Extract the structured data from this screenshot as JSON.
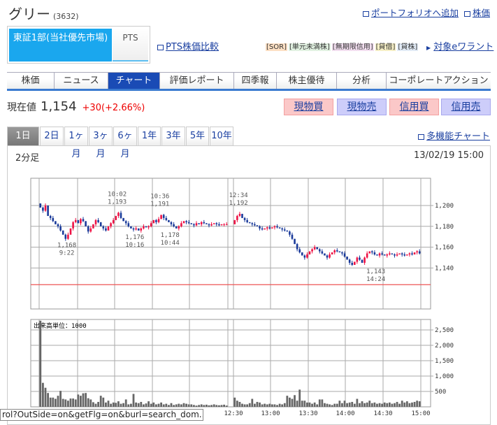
{
  "header": {
    "title": "グリー",
    "code": "(3632)",
    "portfolio_link": "ポートフォリオへ追加",
    "stock_link": "株価"
  },
  "market_tabs": [
    {
      "label": "東証1部(当社優先市場)",
      "active": true
    },
    {
      "label": "PTS",
      "active": false
    }
  ],
  "pts_compare": "PTS株価比較",
  "tags": [
    {
      "label": "[SOR]",
      "color": "#fde0c4"
    },
    {
      "label": "[単元未満株]",
      "color": "#e2f2e2"
    },
    {
      "label": "[無期限信用]",
      "color": "#f3dff0"
    },
    {
      "label": "[貸借]",
      "color": "#f6efc6"
    },
    {
      "label": "[貸株]",
      "color": "#e2ebf6"
    }
  ],
  "ewarrant_link": "対象eワラント",
  "nav": [
    "株価",
    "ニュース",
    "チャート",
    "評価レポート",
    "四季報",
    "株主優待",
    "分析",
    "コーポレートアクション"
  ],
  "price": {
    "label": "現在値",
    "value": "1,154",
    "change": "+30(+2.66%)"
  },
  "trade_buttons": [
    "現物買",
    "現物売",
    "信用買",
    "信用売"
  ],
  "periods": [
    "1日",
    "2日",
    "1ヶ月",
    "3ヶ月",
    "6ヶ月",
    "1年",
    "3年",
    "5年",
    "10年"
  ],
  "multichart_link": "多機能チャート",
  "chart_header": {
    "interval": "2分足",
    "timestamp": "13/02/19 15:00"
  },
  "status_bar": "rol?OutSide=on&getFlg=on&burl=search_dom...",
  "colors": {
    "up": "#ee1144",
    "down": "#1a3a9a",
    "prev_close": "#ee5555"
  },
  "chart_data": {
    "type": "candlestick",
    "interval_minutes": 2,
    "price_axis": {
      "ticks": [
        "1,200",
        "1,180",
        "1,160",
        "1,140"
      ],
      "values": [
        1200,
        1180,
        1160,
        1140
      ],
      "ylim": [
        1114,
        1226
      ]
    },
    "prev_close": 1124,
    "volume_axis": {
      "label": "出来高単位：1000",
      "ticks": [
        "2,500",
        "2,000",
        "1,500",
        "1,000",
        "500"
      ],
      "values": [
        2500,
        2000,
        1500,
        1000,
        500
      ],
      "ylim": [
        0,
        2840
      ]
    },
    "time_ticks": [
      "12:30",
      "13:00",
      "13:30",
      "14:00",
      "14:30",
      "15:00"
    ],
    "annotations": [
      {
        "time": "9:22",
        "price": "1,168",
        "pos": "below"
      },
      {
        "time": "10:02",
        "price": "1,193",
        "pos": "above"
      },
      {
        "time": "10:16",
        "price": "1,176",
        "pos": "below"
      },
      {
        "time": "10:36",
        "price": "1,191",
        "pos": "above"
      },
      {
        "time": "10:44",
        "price": "1,178",
        "pos": "below"
      },
      {
        "time": "12:34",
        "price": "1,192",
        "pos": "above"
      },
      {
        "time": "14:24",
        "price": "1,143",
        "pos": "below"
      }
    ],
    "morning_close": [
      1198,
      1195,
      1200,
      1190,
      1188,
      1185,
      1182,
      1180,
      1176,
      1172,
      1168,
      1172,
      1178,
      1184,
      1186,
      1183,
      1187,
      1185,
      1180,
      1175,
      1178,
      1182,
      1186,
      1184,
      1180,
      1178,
      1176,
      1180,
      1183,
      1186,
      1190,
      1193,
      1188,
      1185,
      1183,
      1180,
      1178,
      1177,
      1178,
      1176,
      1178,
      1180,
      1179,
      1180,
      1183,
      1186,
      1184,
      1187,
      1191,
      1188,
      1186,
      1184,
      1182,
      1180,
      1178,
      1180,
      1183,
      1185,
      1184,
      1183,
      1182,
      1181,
      1183,
      1182,
      1184,
      1183,
      1182,
      1181,
      1182,
      1183,
      1182,
      1181,
      1182,
      1182,
      1182
    ],
    "afternoon_close": [
      1186,
      1190,
      1192,
      1188,
      1186,
      1184,
      1183,
      1182,
      1181,
      1180,
      1178,
      1177,
      1178,
      1179,
      1178,
      1179,
      1180,
      1179,
      1178,
      1177,
      1176,
      1175,
      1172,
      1168,
      1163,
      1158,
      1155,
      1152,
      1150,
      1153,
      1156,
      1158,
      1160,
      1158,
      1156,
      1154,
      1152,
      1150,
      1153,
      1155,
      1157,
      1156,
      1155,
      1154,
      1151,
      1148,
      1145,
      1143,
      1146,
      1150,
      1148,
      1145,
      1150,
      1154,
      1156,
      1155,
      1153,
      1152,
      1154,
      1153,
      1152,
      1153,
      1154,
      1153,
      1152,
      1153,
      1154,
      1153,
      1152,
      1153,
      1154,
      1153,
      1155,
      1156,
      1154
    ],
    "morning_volume": [
      2800,
      780,
      620,
      450,
      300,
      300,
      260,
      360,
      520,
      260,
      240,
      200,
      270,
      270,
      240,
      400,
      360,
      440,
      450,
      280,
      240,
      150,
      100,
      160,
      360,
      300,
      140,
      200,
      100,
      140,
      130,
      180,
      100,
      120,
      240,
      80,
      100,
      420,
      140,
      120,
      160,
      80,
      110,
      180,
      100,
      140,
      80,
      100,
      140,
      80,
      100,
      60,
      120,
      60,
      80,
      100,
      80,
      120,
      100,
      80,
      80,
      60,
      40,
      60,
      80,
      60,
      70,
      50,
      60,
      80,
      60,
      50,
      60,
      70,
      40
    ],
    "afternoon_volume": [
      300,
      200,
      160,
      100,
      80,
      80,
      120,
      260,
      100,
      160,
      140,
      80,
      100,
      80,
      100,
      80,
      80,
      60,
      100,
      80,
      120,
      360,
      300,
      260,
      380,
      200,
      560,
      200,
      200,
      140,
      140,
      100,
      140,
      80,
      240,
      240,
      120,
      100,
      80,
      60,
      100,
      100,
      200,
      120,
      200,
      120,
      140,
      160,
      100,
      260,
      120,
      180,
      120,
      140,
      200,
      120,
      140,
      100,
      120,
      100,
      140,
      120,
      140,
      100,
      120,
      160,
      100,
      200,
      140,
      180,
      120,
      140,
      160,
      200,
      180
    ]
  }
}
